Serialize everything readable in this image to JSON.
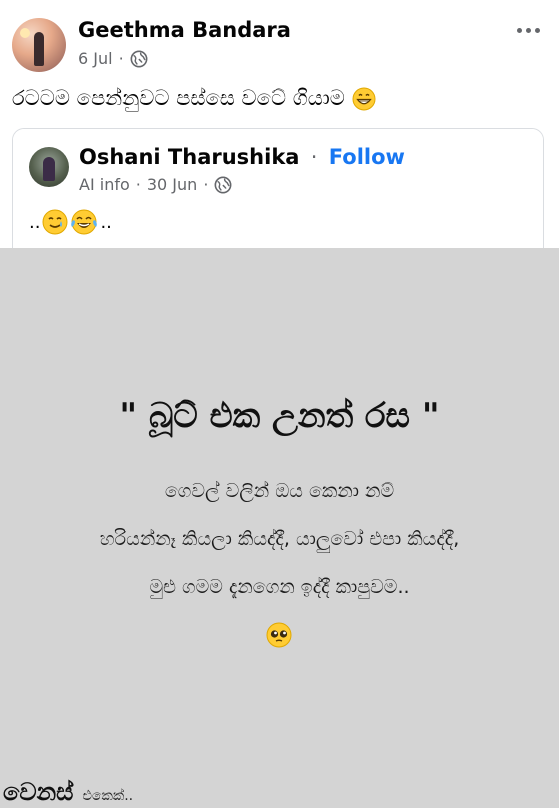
{
  "post": {
    "author": "Geethma Bandara",
    "date": "6 Jul",
    "separator": "·",
    "caption": "රටටම පෙන්නුවට පස්සෙ වටේ ගියාම"
  },
  "shared": {
    "author": "Oshani Tharushika",
    "follow_label": "Follow",
    "separator": "·",
    "source": "AI info",
    "date": "30 Jun",
    "text_prefix": "..",
    "text_suffix": ".."
  },
  "image": {
    "title": "\" බූට් එක උනත් රස \"",
    "lines": [
      "ගෙවල් වලින් ඔය කෙනා නම්",
      "හරියන්නෑ කියලා කියද්දී, යාලුවෝ එපා කියද්දී,",
      "මුළු ගමම දැනගෙන ඉද්දී කාපුවම.."
    ],
    "watermark_main": "වෙනස්",
    "watermark_sub": "එකෙක්.."
  },
  "icons": {
    "globe": "globe-icon",
    "more": "more-options-icon",
    "grin": "grinning-face-icon",
    "crying_smile": "smiling-face-with-tear-icon",
    "laugh_tears": "face-with-tears-of-joy-icon",
    "pleading": "pleading-face-icon"
  },
  "colors": {
    "follow": "#1877f2",
    "meta_text": "#65676b",
    "image_background": "#d4d4d4"
  }
}
